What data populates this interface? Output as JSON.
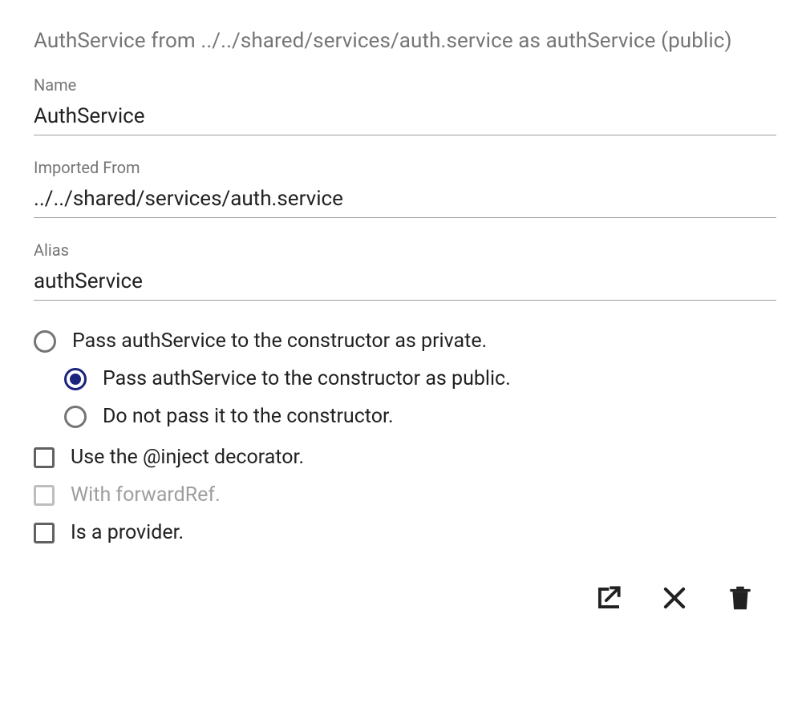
{
  "header": "AuthService from ../../shared/services/auth.service as authService (public)",
  "fields": {
    "name": {
      "label": "Name",
      "value": "AuthService"
    },
    "importedFrom": {
      "label": "Imported From",
      "value": "../../shared/services/auth.service"
    },
    "alias": {
      "label": "Alias",
      "value": "authService"
    }
  },
  "radios": {
    "private": {
      "label": "Pass authService to the constructor as private.",
      "selected": false
    },
    "public": {
      "label": "Pass authService to the constructor as public.",
      "selected": true
    },
    "none": {
      "label": "Do not pass it to the constructor.",
      "selected": false
    }
  },
  "checkboxes": {
    "inject": {
      "label": "Use the @inject decorator.",
      "checked": false,
      "disabled": false
    },
    "forwardRef": {
      "label": "With forwardRef.",
      "checked": false,
      "disabled": true
    },
    "provider": {
      "label": "Is a provider.",
      "checked": false,
      "disabled": false
    }
  }
}
